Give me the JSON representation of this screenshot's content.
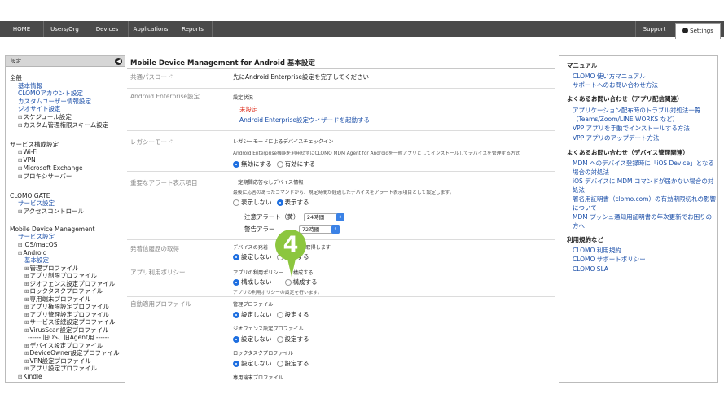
{
  "topnav": {
    "tabs": [
      "HOME",
      "Users/Org",
      "Devices",
      "Applications",
      "Reports"
    ],
    "support": "Support",
    "settings": "Settings"
  },
  "leftnav": {
    "header": "設定",
    "items": [
      {
        "text": "全般",
        "type": "hd"
      },
      {
        "text": "基本情報",
        "type": "lk"
      },
      {
        "text": "CLOMOアカウント設定",
        "type": "lk"
      },
      {
        "text": "カスタムユーザー情報設定",
        "type": "lk"
      },
      {
        "text": "ジオサイト設定",
        "type": "lk"
      },
      {
        "text": "スケジュール設定",
        "type": "bx"
      },
      {
        "text": "カスタム管理権限スキーム設定",
        "type": "bx"
      },
      {
        "text": "サービス構成設定",
        "type": "hd"
      },
      {
        "text": "Wi-Fi",
        "type": "bx"
      },
      {
        "text": "VPN",
        "type": "bx"
      },
      {
        "text": "Microsoft Exchange",
        "type": "bx"
      },
      {
        "text": "プロキシサーバー",
        "type": "bx"
      },
      {
        "text": "CLOMO GATE",
        "type": "hd"
      },
      {
        "text": "サービス設定",
        "type": "lk"
      },
      {
        "text": "アクセスコントロール",
        "type": "bx"
      },
      {
        "text": "Mobile Device Management",
        "type": "hd"
      },
      {
        "text": "サービス設定",
        "type": "lk"
      },
      {
        "text": "iOS/macOS",
        "type": "bx"
      },
      {
        "text": "Android",
        "type": "bx"
      },
      {
        "text": "基本設定",
        "type": "lk"
      },
      {
        "text": "管理プロファイル",
        "type": "bx"
      },
      {
        "text": "アプリ制限プロファイル",
        "type": "bx"
      },
      {
        "text": "ジオフェンス設定プロファイル",
        "type": "bx"
      },
      {
        "text": "ロックタスクプロファイル",
        "type": "bx"
      },
      {
        "text": "専用端末プロファイル",
        "type": "bx"
      },
      {
        "text": "アプリ権限設定プロファイル",
        "type": "bx"
      },
      {
        "text": "アプリ管理設定プロファイル",
        "type": "bx"
      },
      {
        "text": "サービス接続設定プロファイル",
        "type": "bx"
      },
      {
        "text": "VirusScan設定プロファイル",
        "type": "bx"
      },
      {
        "text": "------ 旧OS、旧Agent用 ------",
        "type": "hd"
      },
      {
        "text": "デバイス設定プロファイル",
        "type": "bx"
      },
      {
        "text": "DeviceOwner設定プロファイル",
        "type": "bx"
      },
      {
        "text": "VPN設定プロファイル",
        "type": "bx"
      },
      {
        "text": "アプリ設定プロファイル",
        "type": "bx"
      },
      {
        "text": "Kindle",
        "type": "bx"
      }
    ]
  },
  "main": {
    "title": "Mobile Device Management for Android 基本設定",
    "rows": {
      "common_pass": {
        "label": "共通パスコード",
        "text": "先にAndroid Enterprise設定を完了してください"
      },
      "ae": {
        "label": "Android Enterprise設定",
        "sub": "設定状況",
        "status": "未設定",
        "link": "Android Enterprise設定ウィザードを起動する"
      },
      "legacy": {
        "label": "レガシーモード",
        "sub": "レガシーモードによるデバイスチェックイン",
        "desc": "Android Enterprise機能を利用せずにCLOMO MDM Agent for Androidを一般アプリとしてインストールしてデバイスを管理する方式",
        "opt1": "無効にする",
        "opt2": "有効にする"
      },
      "alert": {
        "label": "重要なアラート表示項目",
        "sub": "一定期間応答なしデバイス情報",
        "desc": "最後に応答のあったコマンドから、規定時間が経過したデバイスをアラート表示項目として設定します。",
        "opt1": "表示しない",
        "opt2": "表示する",
        "caution_label": "注意アラート（黄）",
        "caution_value": "24時間",
        "warn_label": "警告アラー",
        "warn_value": "72時間"
      },
      "history": {
        "label": "発着信履歴の取得",
        "sub_a": "デバイスの発着",
        "sub_b": "取得します",
        "opt1": "設定しない",
        "opt2": "設定する"
      },
      "policy": {
        "label": "アプリ利用ポリシー",
        "sub_a": "アプリの利用ポリシー",
        "sub_b": "構成する",
        "opt1": "構成しない",
        "opt2": "構成する",
        "desc": "アプリの利用ポリシーの設定を行います。"
      },
      "auto": {
        "label": "自動適用プロファイル",
        "groups": [
          {
            "title": "管理プロファイル",
            "opt1": "設定しない",
            "opt2": "設定する"
          },
          {
            "title": "ジオフェンス設定プロファイル",
            "opt1": "設定しない",
            "opt2": "設定する"
          },
          {
            "title": "ロックタスクプロファイル",
            "opt1": "設定しない",
            "opt2": "設定する"
          },
          {
            "title": "専用端末プロファイル",
            "opt1": "",
            "opt2": ""
          }
        ]
      }
    },
    "step_badge": "4",
    "accent_color": "#8cc63f",
    "radio_color": "#1e6fe0"
  },
  "rightnav": {
    "manual_title": "マニュアル",
    "manual_links": [
      "CLOMO 使い方マニュアル",
      "サポートへのお問い合わせ方法"
    ],
    "faq1_title": "よくあるお問い合わせ（アプリ配信関連）",
    "faq1_links": [
      "アプリケーション配布時のトラブル対処法一覧（Teams/Zoom/LINE WORKS など）",
      "VPP アプリを手動でインストールする方法",
      "VPP アプリのアップデート方法"
    ],
    "faq2_title": "よくあるお問い合わせ（デバイス管理関連）",
    "faq2_links": [
      "MDM へのデバイス登録時に「iOS Device」となる場合の対処法",
      "iOS デバイスに MDM コマンドが届かない場合の対処法",
      "署名用証明書（clomo.com）の有効期限切れの影響について",
      "MDM プッシュ通知用証明書の年次更新でお困りの方へ"
    ],
    "terms_title": "利用規約など",
    "terms_links": [
      "CLOMO 利用規約",
      "CLOMO サポートポリシー",
      "CLOMO SLA"
    ]
  }
}
